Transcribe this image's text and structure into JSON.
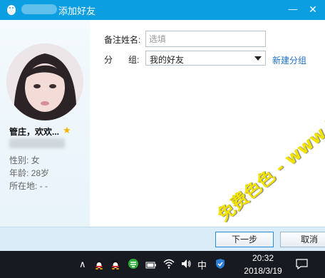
{
  "window": {
    "title": "添加好友",
    "minimize_glyph": "—",
    "close_glyph": "✕"
  },
  "profile": {
    "nickname": "管庄，欢欢...",
    "gender": "性别: 女",
    "age": "年龄: 28岁",
    "location": "所在地: -    -"
  },
  "form": {
    "remark_label": "备注姓名:",
    "remark_placeholder": "选填",
    "group_label_a": "分",
    "group_label_b": "组:",
    "group_selected": "我的好友",
    "new_group_link": "新建分组"
  },
  "buttons": {
    "next": "下一步",
    "cancel": "取消"
  },
  "taskbar": {
    "chevron": "∧",
    "ime": "中",
    "time": "20:32",
    "date": "2018/3/19"
  },
  "watermark": {
    "text": "免费色色 - www.MFsese.com"
  },
  "colors": {
    "titlebar": "#0b9ee0",
    "link": "#1f72c4",
    "button_bar": "#d9ecf8",
    "taskbar": "#171a20",
    "watermark": "#f2e300"
  },
  "icons": {
    "app": "qq-penguin-icon",
    "star": "star-icon",
    "tray": [
      "qq-penguin-icon",
      "qq-penguin-icon",
      "green-app-icon",
      "battery-icon",
      "wifi-icon",
      "volume-icon",
      "shield-icon",
      "notification-icon"
    ]
  }
}
